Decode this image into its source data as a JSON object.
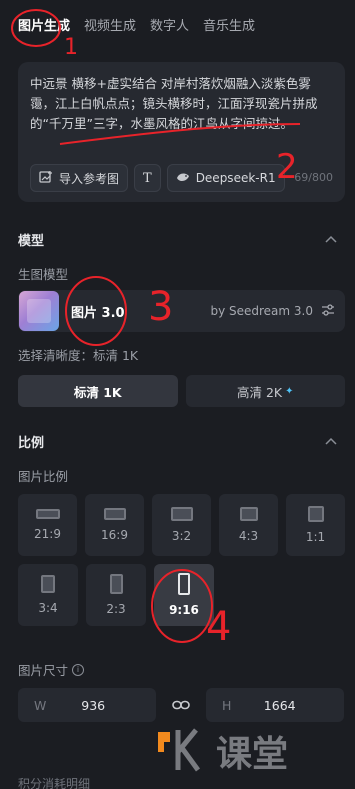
{
  "tabs": [
    "图片生成",
    "视频生成",
    "数字人",
    "音乐生成"
  ],
  "prompt": {
    "text": "中远景 横移+虚实结合 对岸村落炊烟融入淡紫色雾霭，江上白帆点点；镜头横移时，江面浮现瓷片拼成的“千万里”三字，水墨风格的江鸟从字间掠过。",
    "upload_ref": "导入参考图",
    "text_tool": "T",
    "model_btn": "Deepseek-R1",
    "char_count": "69/800"
  },
  "model_section": {
    "title": "模型",
    "sub_label": "生图模型",
    "model_name": "图片 3.0",
    "model_by": "by Seedream 3.0",
    "clarity_label": "选择清晰度：标清 1K",
    "resolution_options": [
      {
        "label": "标清 1K"
      },
      {
        "label": "高清 2K"
      }
    ]
  },
  "ratio_section": {
    "title": "比例",
    "sub_label": "图片比例",
    "ratios": [
      "21:9",
      "16:9",
      "3:2",
      "4:3",
      "1:1",
      "3:4",
      "2:3",
      "9:16"
    ],
    "selected": "9:16"
  },
  "size_section": {
    "label": "图片尺寸",
    "width_axis": "W",
    "width_value": "936",
    "height_axis": "H",
    "height_value": "1664"
  },
  "bottom_label": "积分消耗明细",
  "watermark_text": "课堂",
  "annotations": [
    "1",
    "2",
    "3",
    "4"
  ],
  "colors": {
    "background": "#1b1d22",
    "card": "#262930",
    "accent_sparkle": "#4fc3f7",
    "annotation_red": "#e8232a",
    "watermark_orange": "#f28a1e"
  }
}
